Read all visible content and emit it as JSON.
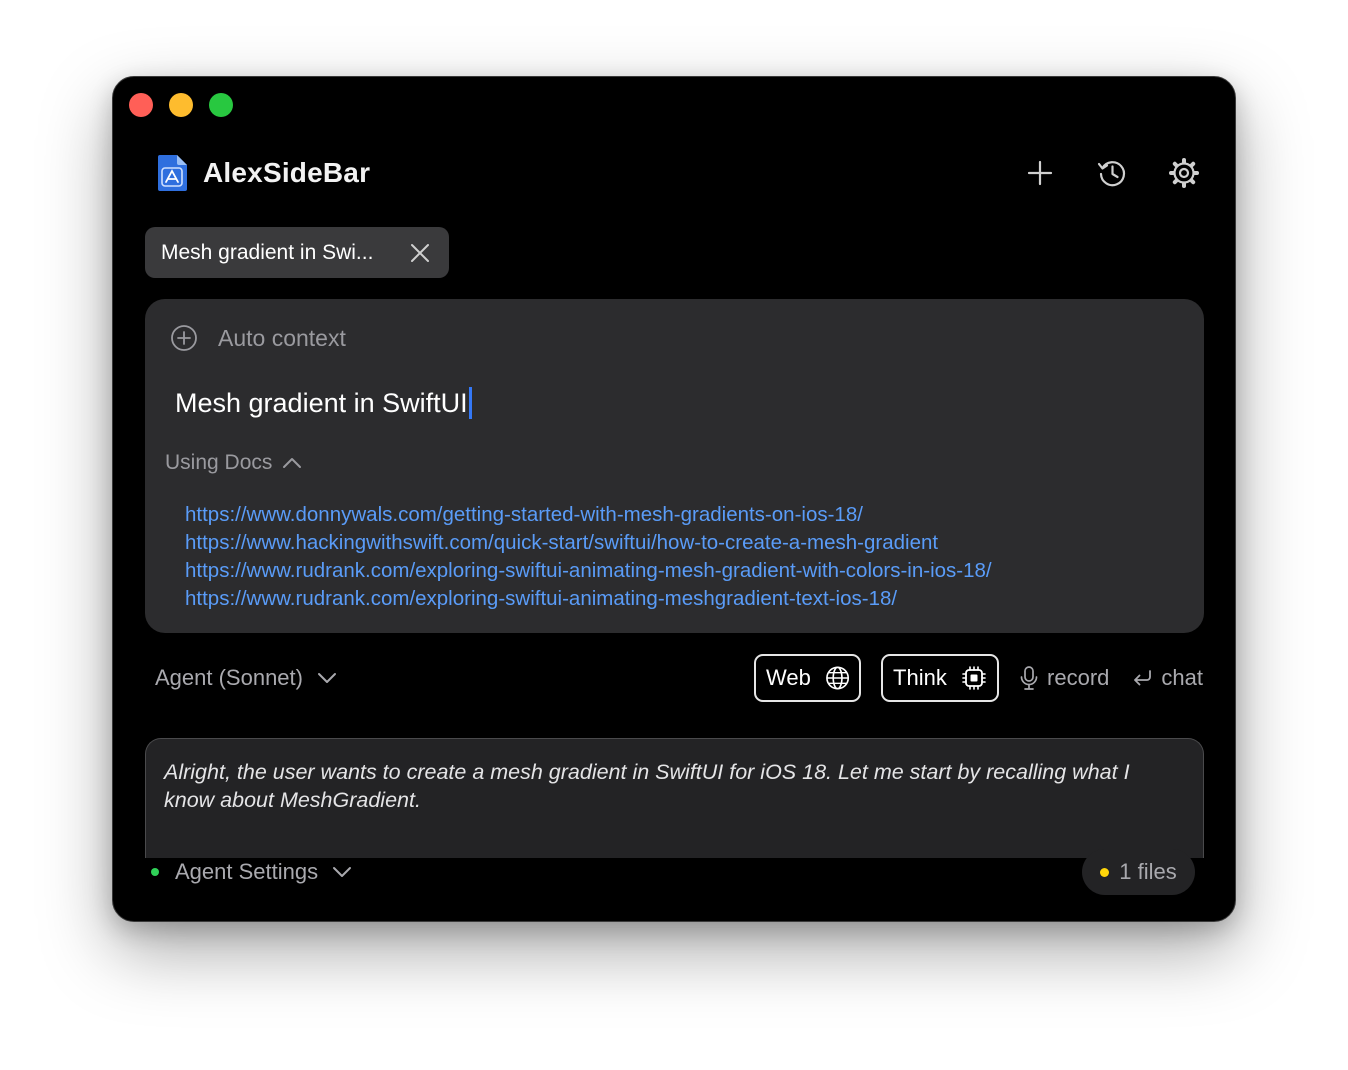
{
  "app": {
    "title": "AlexSideBar"
  },
  "header": {
    "actions": [
      {
        "name": "new-chat",
        "icon": "plus-icon"
      },
      {
        "name": "history",
        "icon": "history-icon"
      },
      {
        "name": "settings",
        "icon": "gear-icon"
      }
    ]
  },
  "tab": {
    "label": "Mesh gradient in Swi...",
    "close_icon": "close-icon"
  },
  "compose": {
    "auto_context_label": "Auto context",
    "query": "Mesh gradient in SwiftUI",
    "using_docs_label": "Using Docs",
    "docs": [
      "https://www.donnywals.com/getting-started-with-mesh-gradients-on-ios-18/",
      "https://www.hackingwithswift.com/quick-start/swiftui/how-to-create-a-mesh-gradient",
      "https://www.rudrank.com/exploring-swiftui-animating-mesh-gradient-with-colors-in-ios-18/",
      "https://www.rudrank.com/exploring-swiftui-animating-meshgradient-text-ios-18/"
    ]
  },
  "toolbar": {
    "agent_label": "Agent (Sonnet)",
    "web_label": "Web",
    "think_label": "Think",
    "record_label": "record",
    "chat_label": "chat"
  },
  "response": {
    "text": "Alright, the user wants to create a mesh gradient in SwiftUI for iOS 18. Let me start by recalling what I know about MeshGradient."
  },
  "footer": {
    "agent_settings_label": "Agent Settings",
    "files_label": "1 files"
  },
  "colors": {
    "window_bg": "#000000",
    "panel_bg": "#2c2c2e",
    "chip_bg": "#3a3a3c",
    "link": "#5a9cf8",
    "caret": "#3478f6",
    "muted_text": "#9a9a9f",
    "status_green": "#30d158",
    "status_yellow": "#ffd60a"
  }
}
